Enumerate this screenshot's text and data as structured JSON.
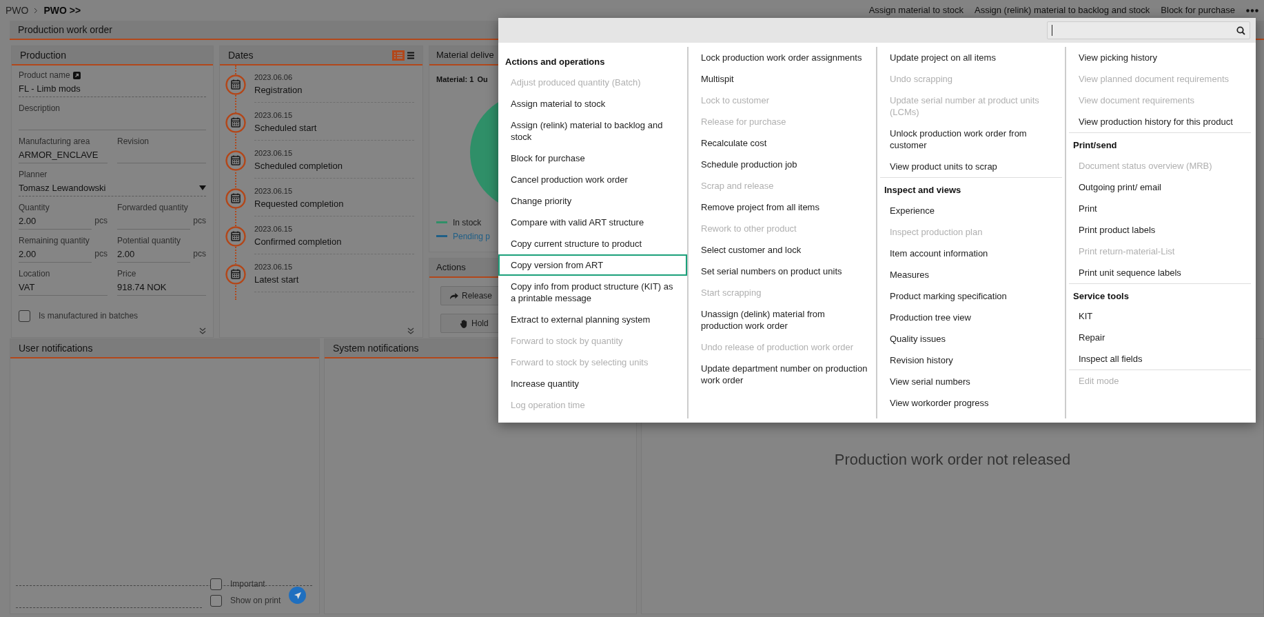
{
  "breadcrumb": [
    {
      "label": "PWO",
      "current": false
    },
    {
      "label": "PWO >>",
      "current": true
    }
  ],
  "top_actions": [
    "Assign material to stock",
    "Assign (relink) material to backlog and stock",
    "Block for purchase"
  ],
  "main_panel": {
    "title": "Production work order"
  },
  "production": {
    "title": "Production",
    "rows": [
      {
        "fields": [
          {
            "kind": "link",
            "label": "Product name",
            "value": "FL - Limb mods"
          }
        ]
      },
      {
        "fields": [
          {
            "kind": "text",
            "label": "Description"
          }
        ]
      },
      {
        "fields": [
          {
            "kind": "text",
            "label": "Manufacturing area",
            "value": "ARMOR_ENCLAVE"
          },
          {
            "kind": "text",
            "label": "Revision"
          }
        ]
      },
      {
        "fields": [
          {
            "kind": "select",
            "label": "Planner",
            "value": "Tomasz Lewandowski"
          }
        ]
      },
      {
        "fields": [
          {
            "kind": "text",
            "label": "Quantity",
            "value": "2.00",
            "unit": "pcs"
          },
          {
            "kind": "text",
            "label": "Forwarded quantity",
            "unit": "pcs"
          }
        ]
      },
      {
        "fields": [
          {
            "kind": "text",
            "label": "Remaining quantity",
            "value": "2.00",
            "unit": "pcs"
          },
          {
            "kind": "text",
            "label": "Potential quantity",
            "value": "2.00",
            "unit": "pcs"
          }
        ]
      },
      {
        "fields": [
          {
            "kind": "text",
            "label": "Location",
            "value": "VAT"
          },
          {
            "kind": "text",
            "label": "Price",
            "value": "918.74 NOK"
          }
        ]
      }
    ],
    "checkbox": {
      "label": "Is manufactured in batches",
      "checked": false
    }
  },
  "dates": {
    "title": "Dates",
    "items": [
      {
        "date": "2023.06.06",
        "label": "Registration"
      },
      {
        "date": "2023.06.15",
        "label": "Scheduled start"
      },
      {
        "date": "2023.06.15",
        "label": "Scheduled completion"
      },
      {
        "date": "2023.06.15",
        "label": "Requested completion"
      },
      {
        "date": "2023.06.15",
        "label": "Confirmed completion"
      },
      {
        "date": "2023.06.15",
        "label": "Latest start"
      }
    ]
  },
  "material": {
    "title": "Material delive",
    "summary": [
      "Material: 1",
      "Ou"
    ],
    "legend": [
      {
        "label": "In stock",
        "color": "#2f8f68"
      },
      {
        "label": "Pending p",
        "color": "#1f5f87"
      }
    ]
  },
  "actions": {
    "title": "Actions",
    "buttons": [
      {
        "kind": "release",
        "label": "Release"
      },
      {
        "kind": "hold",
        "label": "Hold"
      }
    ]
  },
  "user_notifications": {
    "title": "User notifications",
    "options": [
      {
        "label": "Important",
        "checked": false
      },
      {
        "label": "Show on print",
        "checked": false
      }
    ]
  },
  "system_notifications": {
    "title": "System notifications"
  },
  "status_message": "Production work order not released",
  "menu": {
    "columns": [
      {
        "sections": [
          {
            "heading": "Actions and operations",
            "items": [
              {
                "label": "Adjust produced quantity (Batch)",
                "disabled": true,
                "selected": false
              },
              {
                "label": "Assign material to stock",
                "disabled": false,
                "selected": false
              },
              {
                "label": "Assign (relink) material to backlog and stock",
                "disabled": false,
                "selected": false
              },
              {
                "label": "Block for purchase",
                "disabled": false,
                "selected": false
              },
              {
                "label": "Cancel production work order",
                "disabled": false,
                "selected": false
              },
              {
                "label": "Change priority",
                "disabled": false,
                "selected": false
              },
              {
                "label": "Compare with valid ART structure",
                "disabled": false,
                "selected": false
              },
              {
                "label": "Copy current structure to product",
                "disabled": false,
                "selected": false
              },
              {
                "label": "Copy version from ART",
                "disabled": false,
                "selected": true
              },
              {
                "label": "Copy info from product structure (KIT) as a printable message",
                "disabled": false,
                "selected": false
              },
              {
                "label": "Extract to external planning system",
                "disabled": false,
                "selected": false
              },
              {
                "label": "Forward to stock by quantity",
                "disabled": true,
                "selected": false
              },
              {
                "label": "Forward to stock by selecting units",
                "disabled": true,
                "selected": false
              },
              {
                "label": "Increase quantity",
                "disabled": false,
                "selected": false
              },
              {
                "label": "Log operation time",
                "disabled": true,
                "selected": false
              }
            ]
          }
        ]
      },
      {
        "sections": [
          {
            "items": [
              {
                "label": "Lock production work order assignments",
                "disabled": false,
                "selected": false
              },
              {
                "label": "Multispit",
                "disabled": false,
                "selected": false
              },
              {
                "label": "Lock to customer",
                "disabled": true,
                "selected": false
              },
              {
                "label": "Release for purchase",
                "disabled": true,
                "selected": false
              },
              {
                "label": "Recalculate cost",
                "disabled": false,
                "selected": false
              },
              {
                "label": "Schedule production job",
                "disabled": false,
                "selected": false
              },
              {
                "label": "Scrap and release",
                "disabled": true,
                "selected": false
              },
              {
                "label": "Remove project from all items",
                "disabled": false,
                "selected": false
              },
              {
                "label": "Rework to other product",
                "disabled": true,
                "selected": false
              },
              {
                "label": "Select customer and lock",
                "disabled": false,
                "selected": false
              },
              {
                "label": "Set serial numbers on product units",
                "disabled": false,
                "selected": false
              },
              {
                "label": "Start scrapping",
                "disabled": true,
                "selected": false
              },
              {
                "label": "Unassign (delink) material from production work order",
                "disabled": false,
                "selected": false
              },
              {
                "label": "Undo release of production work order",
                "disabled": true,
                "selected": false
              },
              {
                "label": "Update department number on production work order",
                "disabled": false,
                "selected": false
              }
            ]
          }
        ]
      },
      {
        "sections": [
          {
            "items": [
              {
                "label": "Update project on all items",
                "disabled": false,
                "selected": false
              },
              {
                "label": "Undo scrapping",
                "disabled": true,
                "selected": false
              },
              {
                "label": "Update serial number at product units (LCMs)",
                "disabled": true,
                "selected": false
              },
              {
                "label": "Unlock production work order from customer",
                "disabled": false,
                "selected": false
              },
              {
                "label": "View product units to scrap",
                "disabled": false,
                "selected": false
              }
            ]
          },
          {
            "heading": "Inspect and views",
            "items": [
              {
                "label": "Experience",
                "disabled": false,
                "selected": false
              },
              {
                "label": "Inspect production plan",
                "disabled": true,
                "selected": false
              },
              {
                "label": "Item account information",
                "disabled": false,
                "selected": false
              },
              {
                "label": "Measures",
                "disabled": false,
                "selected": false
              },
              {
                "label": "Product marking specification",
                "disabled": false,
                "selected": false
              },
              {
                "label": "Production tree view",
                "disabled": false,
                "selected": false
              },
              {
                "label": "Quality issues",
                "disabled": false,
                "selected": false
              },
              {
                "label": "Revision history",
                "disabled": false,
                "selected": false
              },
              {
                "label": "View serial numbers",
                "disabled": false,
                "selected": false
              },
              {
                "label": "View workorder progress",
                "disabled": false,
                "selected": false
              }
            ]
          }
        ]
      },
      {
        "sections": [
          {
            "items": [
              {
                "label": "View picking history",
                "disabled": false,
                "selected": false
              },
              {
                "label": "View planned document requirements",
                "disabled": true,
                "selected": false
              },
              {
                "label": "View document requirements",
                "disabled": true,
                "selected": false
              },
              {
                "label": "View production history for this product",
                "disabled": false,
                "selected": false
              }
            ]
          },
          {
            "heading": "Print/send",
            "items": [
              {
                "label": "Document status overview (MRB)",
                "disabled": true,
                "selected": false
              },
              {
                "label": "Outgoing print/ email",
                "disabled": false,
                "selected": false
              },
              {
                "label": "Print",
                "disabled": false,
                "selected": false
              },
              {
                "label": "Print product labels",
                "disabled": false,
                "selected": false
              },
              {
                "label": "Print return-material-List",
                "disabled": true,
                "selected": false
              },
              {
                "label": "Print unit sequence labels",
                "disabled": false,
                "selected": false
              }
            ]
          },
          {
            "heading": "Service tools",
            "items": [
              {
                "label": "KIT",
                "disabled": false,
                "selected": false
              },
              {
                "label": "Repair",
                "disabled": false,
                "selected": false
              },
              {
                "label": "Inspect all fields",
                "disabled": false,
                "selected": false
              }
            ]
          },
          {
            "items": [
              {
                "label": "Edit mode",
                "disabled": true,
                "selected": false
              }
            ]
          }
        ]
      }
    ]
  }
}
